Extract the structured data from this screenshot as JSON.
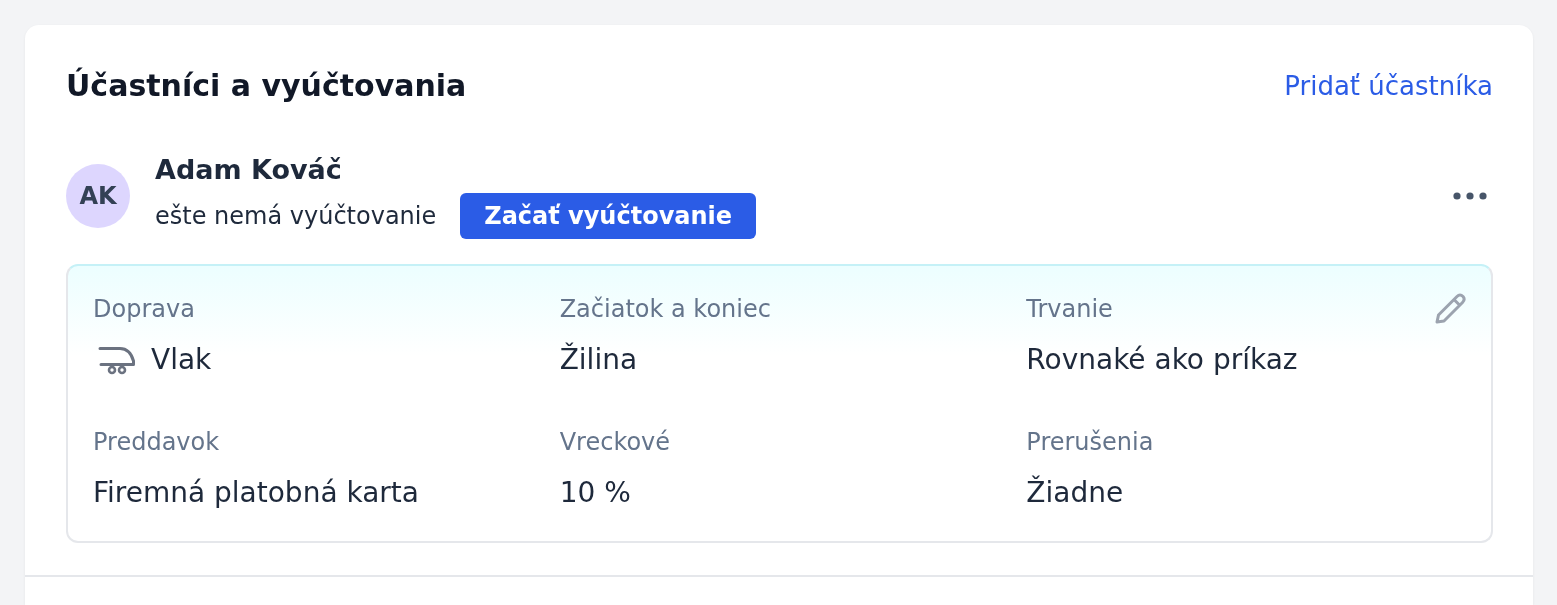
{
  "section": {
    "title": "Účastníci a vyúčtovania",
    "add_link": "Pridať účastníka"
  },
  "participants": [
    {
      "initials": "AK",
      "name": "Adam Kováč",
      "status": "ešte nemá vyúčtovanie",
      "action": "Začať vyúčtovanie",
      "details": [
        {
          "kind": "transport",
          "label": "Doprava",
          "value": "Vlak"
        },
        {
          "kind": "plain",
          "label": "Začiatok a koniec",
          "value": "Žilina"
        },
        {
          "kind": "plain",
          "label": "Trvanie",
          "value": "Rovnaké ako príkaz"
        },
        {
          "kind": "plain",
          "label": "Preddavok",
          "value": "Firemná platobná karta"
        },
        {
          "kind": "plain",
          "label": "Vreckové",
          "value": "10 %"
        },
        {
          "kind": "plain",
          "label": "Prerušenia",
          "value": "Žiadne"
        }
      ]
    }
  ]
}
